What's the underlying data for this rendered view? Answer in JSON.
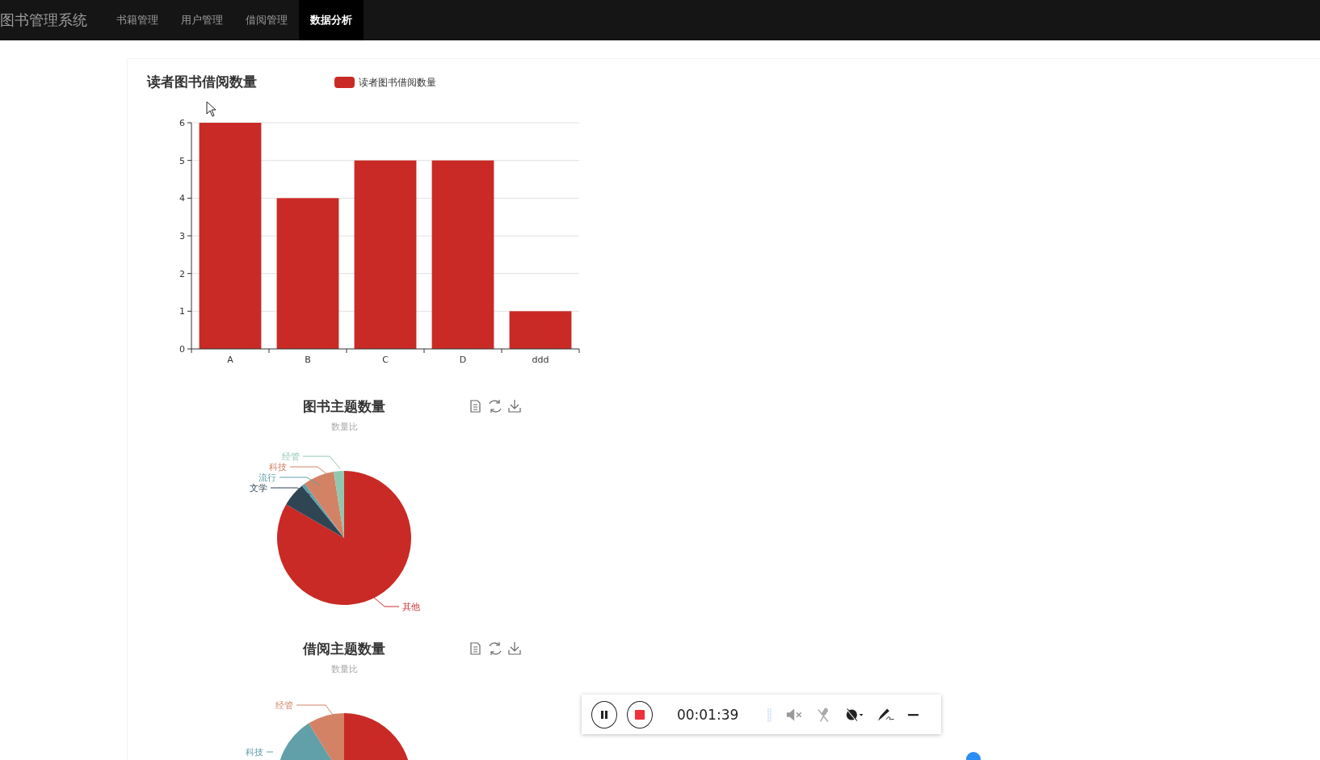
{
  "nav": {
    "brand": "图书管理系统",
    "items": [
      {
        "label": "书籍管理",
        "selected": false
      },
      {
        "label": "用户管理",
        "selected": false
      },
      {
        "label": "借阅管理",
        "selected": false
      },
      {
        "label": "数据分析",
        "selected": true
      }
    ]
  },
  "bar_panel": {
    "chart_data": {
      "type": "bar",
      "title": "读者图书借阅数量",
      "categories": [
        "A",
        "B",
        "C",
        "D",
        "ddd"
      ],
      "series": [
        {
          "name": "读者图书借阅数量",
          "color": "#c92a25",
          "values": [
            6,
            4,
            5,
            5,
            1
          ]
        }
      ],
      "grid": true,
      "ylim": [
        0,
        6
      ],
      "yticks": [
        0,
        1,
        2,
        3,
        4,
        5,
        6
      ]
    }
  },
  "pies": [
    {
      "title": "图书主题数量",
      "subtitle": "数量比",
      "labels": [
        {
          "text": "经管",
          "color": "#91c7ae"
        },
        {
          "text": "科技",
          "color": "#d48265"
        },
        {
          "text": "流行",
          "color": "#61a0a8"
        },
        {
          "text": "文学",
          "color": "#2f4554"
        },
        {
          "text": "其他",
          "color": "#c92a25"
        }
      ]
    },
    {
      "title": "借阅主题数量",
      "subtitle": "数量比",
      "labels": [
        {
          "text": "经管",
          "color": "#d48265"
        },
        {
          "text": "科技",
          "color": "#61a0a8"
        }
      ]
    }
  ],
  "recorder": {
    "time": "00:01:39"
  }
}
